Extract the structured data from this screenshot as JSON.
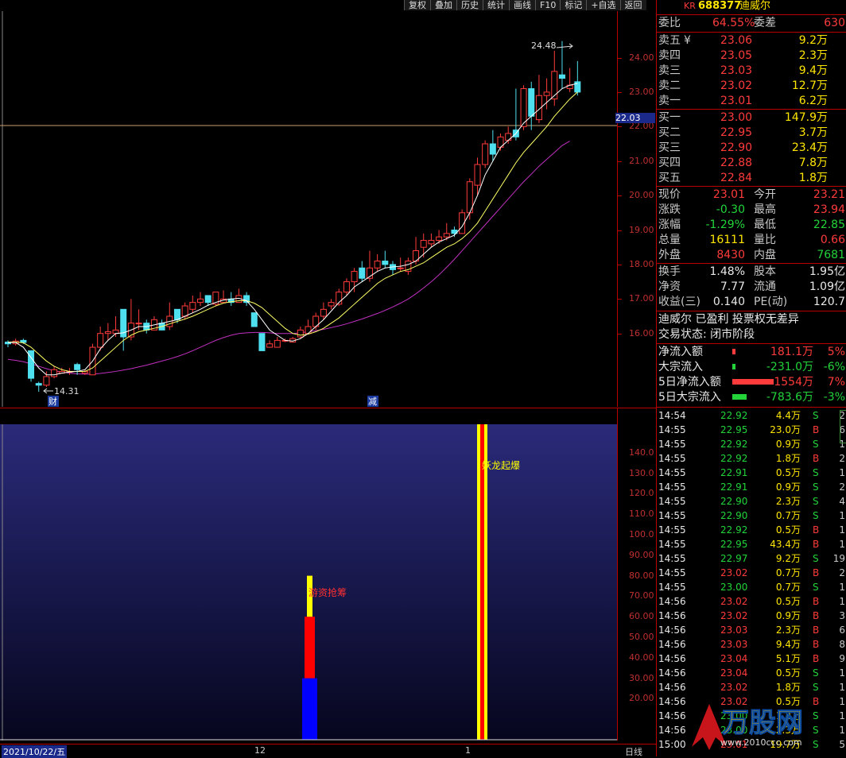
{
  "toolbar": [
    "复权",
    "叠加",
    "历史",
    "统计",
    "画线",
    "F10",
    "标记",
    "+自选",
    "返回"
  ],
  "stock": {
    "code": "688377",
    "name": "迪威尔",
    "badge": "KR"
  },
  "main_chart": {
    "y_ticks": [
      "24.00",
      "23.00",
      "22.00",
      "21.00",
      "20.00",
      "19.00",
      "18.00",
      "17.00",
      "16.00"
    ],
    "current_price_tag": "22.03",
    "high_label": "24.48",
    "low_label": "14.31",
    "markers": {
      "cai": "财",
      "jian": "减"
    },
    "candles": [
      [
        15.75,
        15.7,
        15.8,
        15.6
      ],
      [
        15.7,
        15.78,
        15.85,
        15.65
      ],
      [
        15.8,
        15.74,
        15.85,
        15.7
      ],
      [
        15.5,
        14.7,
        15.5,
        14.6
      ],
      [
        14.55,
        14.5,
        14.6,
        14.31
      ],
      [
        14.5,
        14.75,
        14.9,
        14.45
      ],
      [
        14.75,
        14.95,
        15.05,
        14.7
      ],
      [
        14.85,
        14.9,
        15.0,
        14.85
      ],
      [
        14.9,
        14.9,
        15.0,
        14.8
      ],
      [
        15.1,
        14.95,
        15.15,
        14.8
      ],
      [
        14.85,
        14.9,
        14.95,
        14.8
      ],
      [
        14.8,
        15.6,
        15.7,
        14.8
      ],
      [
        15.6,
        16.0,
        16.2,
        15.5
      ],
      [
        16.0,
        16.05,
        16.3,
        15.8
      ],
      [
        16.0,
        16.1,
        16.5,
        15.9
      ],
      [
        16.7,
        15.9,
        16.7,
        15.5
      ],
      [
        15.9,
        16.3,
        17.0,
        15.8
      ],
      [
        16.3,
        16.3,
        16.7,
        16.1
      ],
      [
        16.3,
        16.1,
        16.4,
        16.0
      ],
      [
        16.1,
        16.4,
        16.5,
        16.1
      ],
      [
        16.3,
        16.1,
        16.4,
        16.1
      ],
      [
        16.2,
        16.5,
        16.9,
        16.1
      ],
      [
        16.7,
        16.4,
        16.7,
        16.3
      ],
      [
        16.5,
        16.8,
        16.9,
        16.4
      ],
      [
        16.7,
        16.9,
        17.1,
        16.6
      ],
      [
        16.9,
        17.0,
        17.2,
        16.8
      ],
      [
        17.1,
        16.9,
        17.1,
        16.8
      ],
      [
        16.85,
        17.2,
        17.2,
        16.8
      ],
      [
        16.9,
        17.0,
        17.25,
        16.9
      ],
      [
        17.0,
        16.9,
        17.2,
        16.8
      ],
      [
        16.9,
        17.1,
        17.3,
        16.9
      ],
      [
        17.1,
        16.9,
        17.2,
        16.8
      ],
      [
        16.6,
        16.2,
        16.6,
        16.2
      ],
      [
        16.0,
        15.5,
        16.0,
        15.6
      ],
      [
        15.6,
        15.7,
        15.8,
        15.6
      ],
      [
        15.6,
        15.8,
        15.9,
        15.6
      ],
      [
        15.8,
        15.8,
        15.85,
        15.75
      ],
      [
        15.75,
        15.85,
        15.9,
        15.75
      ],
      [
        15.9,
        16.1,
        16.2,
        15.85
      ],
      [
        16.0,
        16.2,
        16.4,
        16.0
      ],
      [
        16.2,
        16.5,
        16.6,
        16.1
      ],
      [
        16.5,
        16.7,
        16.9,
        16.4
      ],
      [
        16.8,
        16.9,
        17.0,
        16.7
      ],
      [
        16.85,
        17.2,
        17.3,
        16.8
      ],
      [
        17.2,
        17.5,
        17.6,
        17.1
      ],
      [
        17.5,
        17.8,
        17.9,
        17.2
      ],
      [
        17.9,
        17.6,
        18.1,
        17.5
      ],
      [
        17.6,
        17.9,
        18.4,
        17.5
      ],
      [
        17.9,
        18.1,
        18.3,
        17.8
      ],
      [
        18.1,
        18.0,
        18.4,
        17.9
      ],
      [
        18.0,
        17.85,
        18.1,
        17.7
      ],
      [
        17.9,
        17.9,
        18.2,
        17.8
      ],
      [
        17.8,
        18.1,
        18.2,
        17.7
      ],
      [
        18.1,
        18.4,
        18.8,
        18.0
      ],
      [
        18.5,
        18.7,
        18.9,
        18.2
      ],
      [
        18.6,
        18.7,
        18.9,
        18.5
      ],
      [
        18.7,
        18.8,
        19.0,
        18.6
      ],
      [
        18.8,
        18.9,
        19.2,
        18.7
      ],
      [
        19.0,
        18.9,
        19.1,
        18.8
      ],
      [
        18.9,
        19.5,
        19.6,
        18.9
      ],
      [
        19.5,
        20.4,
        20.5,
        19.3
      ],
      [
        20.3,
        20.9,
        21.1,
        20.0
      ],
      [
        20.9,
        21.5,
        21.6,
        20.8
      ],
      [
        21.5,
        21.2,
        21.9,
        21.0
      ],
      [
        21.4,
        21.7,
        21.8,
        21.3
      ],
      [
        21.6,
        21.8,
        22.0,
        21.5
      ],
      [
        21.9,
        21.7,
        23.1,
        21.6
      ],
      [
        22.0,
        23.1,
        23.2,
        21.9
      ],
      [
        23.1,
        22.3,
        23.3,
        21.9
      ],
      [
        22.2,
        22.9,
        23.5,
        22.1
      ],
      [
        22.9,
        23.0,
        23.4,
        22.5
      ],
      [
        22.8,
        23.6,
        24.2,
        22.6
      ],
      [
        23.5,
        23.4,
        24.48,
        23.1
      ],
      [
        23.1,
        23.2,
        23.7,
        23.0
      ],
      [
        23.3,
        23.0,
        23.9,
        22.9
      ]
    ],
    "ma_short": [
      15.74,
      15.74,
      15.6,
      15.3,
      15.0,
      14.8,
      14.8,
      14.85,
      14.88,
      14.9,
      14.95,
      15.2,
      15.55,
      15.8,
      16.0,
      16.02,
      16.1,
      16.2,
      16.2,
      16.25,
      16.3,
      16.35,
      16.4,
      16.5,
      16.6,
      16.7,
      16.82,
      16.9,
      16.97,
      17.0,
      17.02,
      16.95,
      16.7,
      16.4,
      16.1,
      15.95,
      15.8,
      15.78,
      15.85,
      16.0,
      16.2,
      16.4,
      16.65,
      16.9,
      17.1,
      17.35,
      17.5,
      17.65,
      17.8,
      17.9,
      17.93,
      17.95,
      18.0,
      18.1,
      18.3,
      18.5,
      18.65,
      18.75,
      18.85,
      19.1,
      19.5,
      20.0,
      20.6,
      21.0,
      21.4,
      21.6,
      21.8,
      22.1,
      22.3,
      22.5,
      22.7,
      22.9,
      23.1,
      23.2,
      23.25
    ],
    "ma_mid": [
      15.75,
      15.75,
      15.73,
      15.6,
      15.4,
      15.2,
      15.05,
      14.95,
      14.9,
      14.9,
      14.9,
      15.0,
      15.2,
      15.4,
      15.6,
      15.8,
      15.95,
      16.05,
      16.1,
      16.15,
      16.2,
      16.28,
      16.35,
      16.42,
      16.5,
      16.6,
      16.7,
      16.8,
      16.88,
      16.92,
      16.95,
      16.95,
      16.88,
      16.75,
      16.55,
      16.35,
      16.15,
      16.0,
      15.95,
      15.98,
      16.05,
      16.15,
      16.3,
      16.45,
      16.65,
      16.85,
      17.05,
      17.25,
      17.45,
      17.6,
      17.7,
      17.8,
      17.85,
      17.95,
      18.05,
      18.2,
      18.35,
      18.5,
      18.6,
      18.75,
      18.95,
      19.2,
      19.55,
      19.9,
      20.25,
      20.6,
      20.95,
      21.25,
      21.5,
      21.75,
      22.0,
      22.3,
      22.55,
      22.8,
      23.0
    ],
    "ma_long": [
      15.25,
      15.22,
      15.18,
      15.12,
      15.05,
      14.98,
      14.92,
      14.88,
      14.85,
      14.83,
      14.82,
      14.82,
      14.84,
      14.87,
      14.9,
      14.94,
      14.98,
      15.03,
      15.08,
      15.14,
      15.2,
      15.26,
      15.33,
      15.41,
      15.5,
      15.6,
      15.7,
      15.8,
      15.88,
      15.95,
      16.0,
      16.02,
      16.03,
      16.03,
      16.02,
      16.0,
      16.0,
      16.0,
      16.02,
      16.05,
      16.08,
      16.12,
      16.17,
      16.22,
      16.28,
      16.35,
      16.42,
      16.5,
      16.58,
      16.67,
      16.77,
      16.88,
      17.0,
      17.15,
      17.32,
      17.5,
      17.7,
      17.92,
      18.15,
      18.4,
      18.65,
      18.9,
      19.15,
      19.4,
      19.65,
      19.9,
      20.15,
      20.4,
      20.62,
      20.85,
      21.05,
      21.25,
      21.45,
      21.58
    ]
  },
  "indicator": {
    "y_ticks": [
      "140.0",
      "130.0",
      "120.0",
      "110.0",
      "100.0",
      "90.00",
      "80.00",
      "70.00",
      "60.00",
      "50.00",
      "40.00",
      "30.00",
      "20.00"
    ],
    "label_zijin": "游资抢筹",
    "label_yinglong": "妖龙起爆",
    "bar_segments": {
      "blue_top": 30,
      "red_top": 60,
      "yellow_top": 80
    }
  },
  "bottom_axis": {
    "date": "2021/10/22/五",
    "m12": "12",
    "m1": "1",
    "period": "日线"
  },
  "orderbook": {
    "ratio_label": "委比",
    "ratio": "64.55%",
    "diff_label": "委差",
    "diff": "630",
    "asks": [
      {
        "label": "卖五",
        "mark": "¥",
        "price": "23.06",
        "vol": "9.2万"
      },
      {
        "label": "卖四",
        "price": "23.05",
        "vol": "2.3万"
      },
      {
        "label": "卖三",
        "price": "23.03",
        "vol": "9.4万"
      },
      {
        "label": "卖二",
        "price": "23.02",
        "vol": "12.7万"
      },
      {
        "label": "卖一",
        "price": "23.01",
        "vol": "6.2万"
      }
    ],
    "bids": [
      {
        "label": "买一",
        "price": "23.00",
        "vol": "147.9万"
      },
      {
        "label": "买二",
        "price": "22.95",
        "vol": "3.7万"
      },
      {
        "label": "买三",
        "price": "22.90",
        "vol": "23.4万"
      },
      {
        "label": "买四",
        "price": "22.88",
        "vol": "7.8万"
      },
      {
        "label": "买五",
        "price": "22.84",
        "vol": "1.8万"
      }
    ]
  },
  "quote": [
    {
      "l1": "现价",
      "v1": "23.01",
      "l2": "今开",
      "v2": "23.21"
    },
    {
      "l1": "涨跌",
      "v1": "-0.30",
      "l2": "最高",
      "v2": "23.94"
    },
    {
      "l1": "涨幅",
      "v1": "-1.29%",
      "l2": "最低",
      "v2": "22.85"
    },
    {
      "l1": "总量",
      "v1": "16111",
      "l2": "量比",
      "v2": "0.66"
    },
    {
      "l1": "外盘",
      "v1": "8430",
      "l2": "内盘",
      "v2": "7681"
    },
    {
      "l1": "换手",
      "v1": "1.48%",
      "l2": "股本",
      "v2": "1.95亿"
    },
    {
      "l1": "净资",
      "v1": "7.77",
      "l2": "流通",
      "v2": "1.09亿"
    },
    {
      "l1": "收益(三)",
      "v1": "0.140",
      "l2": "PE(动)",
      "v2": "120.7"
    }
  ],
  "info": {
    "line1": "迪威尔 已盈利 投票权无差异",
    "line2": "交易状态: 闭市阶段"
  },
  "flows": [
    {
      "label": "净流入额",
      "value": "181.1万",
      "pct": "5%",
      "color": "#ff3b3b",
      "bar": 4
    },
    {
      "label": "大宗流入",
      "value": "-231.0万",
      "pct": "-6%",
      "color": "#22d43a",
      "bar": 4
    },
    {
      "label": "5日净流入额",
      "value": "1554万",
      "pct": "7%",
      "color": "#ff3b3b",
      "bar": 52
    },
    {
      "label": "5日大宗流入",
      "value": "-783.6万",
      "pct": "-3%",
      "color": "#22d43a",
      "bar": 18
    }
  ],
  "ticks": [
    {
      "t": "14:54",
      "p": "22.92",
      "v": "4.4万",
      "s": "S",
      "n": "2"
    },
    {
      "t": "14:55",
      "p": "22.95",
      "v": "23.0万",
      "s": "B",
      "n": "6"
    },
    {
      "t": "14:55",
      "p": "22.92",
      "v": "0.9万",
      "s": "S",
      "n": "1"
    },
    {
      "t": "14:55",
      "p": "22.92",
      "v": "1.8万",
      "s": "B",
      "n": "2"
    },
    {
      "t": "14:55",
      "p": "22.91",
      "v": "0.5万",
      "s": "S",
      "n": "1"
    },
    {
      "t": "14:55",
      "p": "22.91",
      "v": "0.9万",
      "s": "S",
      "n": "2"
    },
    {
      "t": "14:55",
      "p": "22.90",
      "v": "2.3万",
      "s": "S",
      "n": "4"
    },
    {
      "t": "14:55",
      "p": "22.90",
      "v": "0.7万",
      "s": "S",
      "n": "1"
    },
    {
      "t": "14:55",
      "p": "22.92",
      "v": "0.5万",
      "s": "B",
      "n": "1"
    },
    {
      "t": "14:55",
      "p": "22.95",
      "v": "43.4万",
      "s": "B",
      "n": "1"
    },
    {
      "t": "14:55",
      "p": "22.97",
      "v": "9.2万",
      "s": "S",
      "n": "19"
    },
    {
      "t": "14:55",
      "p": "23.02",
      "v": "0.7万",
      "s": "B",
      "n": "2"
    },
    {
      "t": "14:55",
      "p": "23.00",
      "v": "0.7万",
      "s": "S",
      "n": "1"
    },
    {
      "t": "14:56",
      "p": "23.02",
      "v": "0.5万",
      "s": "B",
      "n": "1"
    },
    {
      "t": "14:56",
      "p": "23.02",
      "v": "0.9万",
      "s": "B",
      "n": "3"
    },
    {
      "t": "14:56",
      "p": "23.03",
      "v": "2.3万",
      "s": "B",
      "n": "6"
    },
    {
      "t": "14:56",
      "p": "23.03",
      "v": "9.4万",
      "s": "B",
      "n": "8"
    },
    {
      "t": "14:56",
      "p": "23.04",
      "v": "5.1万",
      "s": "B",
      "n": "9"
    },
    {
      "t": "14:56",
      "p": "23.04",
      "v": "0.5万",
      "s": "S",
      "n": "1"
    },
    {
      "t": "14:56",
      "p": "23.02",
      "v": "1.8万",
      "s": "S",
      "n": "1"
    },
    {
      "t": "14:56",
      "p": "23.02",
      "v": "0.5万",
      "s": "B",
      "n": "1"
    },
    {
      "t": "14:56",
      "p": "23.00",
      "v": "1.2万",
      "s": "S",
      "n": "1"
    },
    {
      "t": "14:56",
      "p": "23.00",
      "v": "2.3万",
      "s": "S",
      "n": "1"
    },
    {
      "t": "15:00",
      "p": "23.01",
      "v": "19.7万",
      "s": "S",
      "n": "5"
    }
  ],
  "watermark": {
    "text": "万股网",
    "url": "www.2010ccc.com"
  },
  "colors": {
    "up": "#ff3b3b",
    "down": "#4fe0f0",
    "ma_short": "#ffffff",
    "ma_mid": "#ffff66",
    "ma_long": "#c030c0",
    "grid_axis": "#bb0000"
  }
}
